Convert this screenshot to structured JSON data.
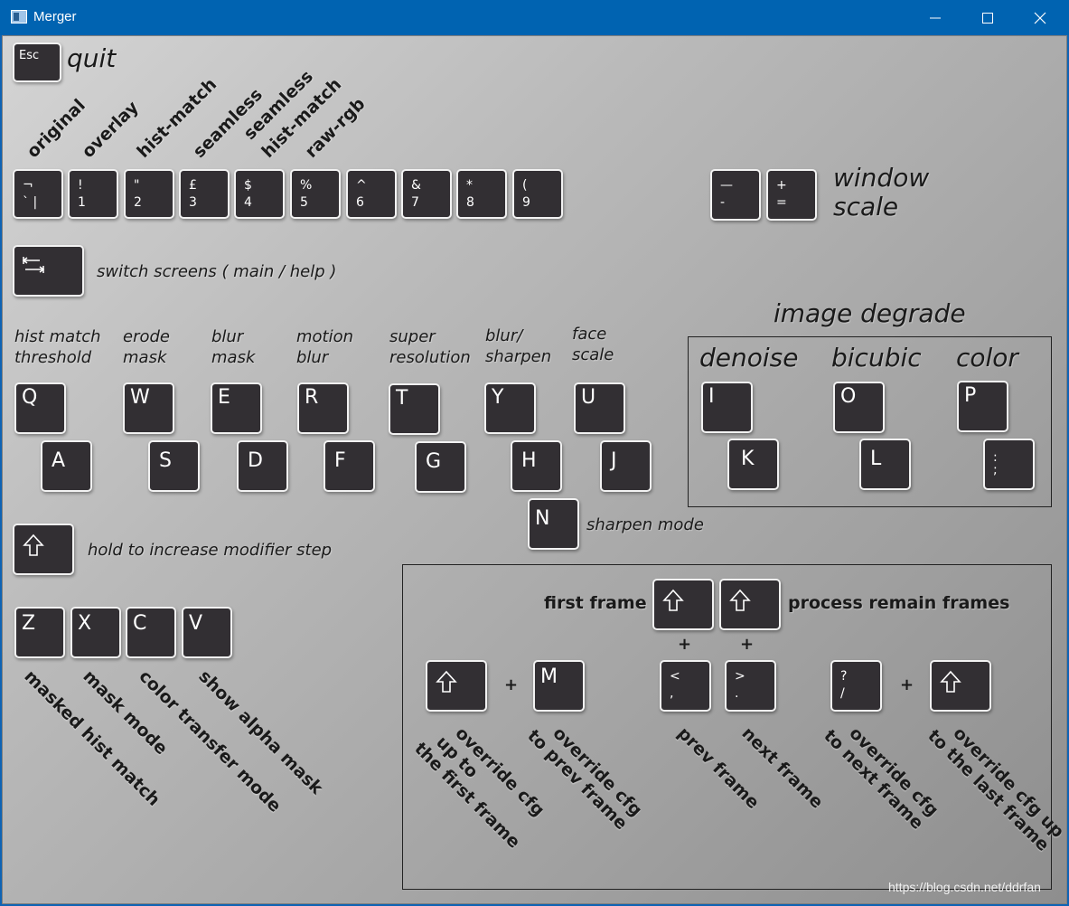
{
  "window": {
    "title": "Merger"
  },
  "quit": {
    "key": "Esc",
    "label": "quit"
  },
  "modes": {
    "labels": [
      "original",
      "overlay",
      "hist-match",
      "seamless",
      "seamless",
      "hist-match",
      "raw-rgb"
    ],
    "keys": [
      {
        "top": "¬",
        "bot": "`  |"
      },
      {
        "top": "!",
        "bot": "1"
      },
      {
        "top": "\"",
        "bot": "2"
      },
      {
        "top": "£",
        "bot": "3"
      },
      {
        "top": "$",
        "bot": "4"
      },
      {
        "top": "%",
        "bot": "5"
      },
      {
        "top": "^",
        "bot": "6"
      },
      {
        "top": "&",
        "bot": "7"
      },
      {
        "top": "*",
        "bot": "8"
      },
      {
        "top": "(",
        "bot": "9"
      }
    ]
  },
  "window_scale": {
    "minus_top": "—",
    "minus_bot": "-",
    "plus_top": "+",
    "plus_bot": "=",
    "label1": "window",
    "label2": "scale"
  },
  "switch_screens": {
    "label": "switch screens ( main / help )"
  },
  "params": {
    "labels": [
      [
        "hist match",
        "threshold"
      ],
      [
        "erode",
        "mask"
      ],
      [
        "blur",
        "mask"
      ],
      [
        "motion",
        "blur"
      ],
      [
        "super",
        "resolution"
      ],
      [
        "blur/",
        "sharpen"
      ],
      [
        "face",
        "scale"
      ]
    ],
    "up_keys": [
      "Q",
      "W",
      "E",
      "R",
      "T",
      "Y",
      "U"
    ],
    "down_keys": [
      "A",
      "S",
      "D",
      "F",
      "G",
      "H",
      "J"
    ]
  },
  "sharpen": {
    "key": "N",
    "label": "sharpen mode"
  },
  "degrade": {
    "title": "image degrade",
    "labels": [
      "denoise",
      "bicubic",
      "color"
    ],
    "up_keys": [
      "I",
      "O",
      "P"
    ],
    "down_keys": [
      "K",
      "L"
    ],
    "semicolon_top": ":",
    "semicolon_bot": ";"
  },
  "modifier": {
    "label": "hold to increase modifier step"
  },
  "masks": {
    "keys": [
      "Z",
      "X",
      "C",
      "V"
    ],
    "labels": [
      "masked hist match",
      "mask mode",
      "color transfer mode",
      "show alpha mask"
    ]
  },
  "frames": {
    "first_frame": "first frame",
    "process_remain": "process remain frames",
    "plus": "+",
    "m_key": "M",
    "prev_top": "<",
    "prev_bot": ",",
    "next_top": ">",
    "next_bot": ".",
    "slash_top": "?",
    "slash_bot": "/",
    "labels": [
      [
        "override cfg",
        "up to",
        "the first frame"
      ],
      [
        "override cfg",
        "to prev frame"
      ],
      [
        "prev frame"
      ],
      [
        "next frame"
      ],
      [
        "override cfg",
        "to next frame"
      ],
      [
        "override cfg up",
        "to the last frame"
      ]
    ]
  },
  "watermark": "https://blog.csdn.net/ddrfan",
  "icons": [
    "app-icon",
    "minimize-icon",
    "maximize-icon",
    "close-icon",
    "tab-icon",
    "shift-icon"
  ]
}
